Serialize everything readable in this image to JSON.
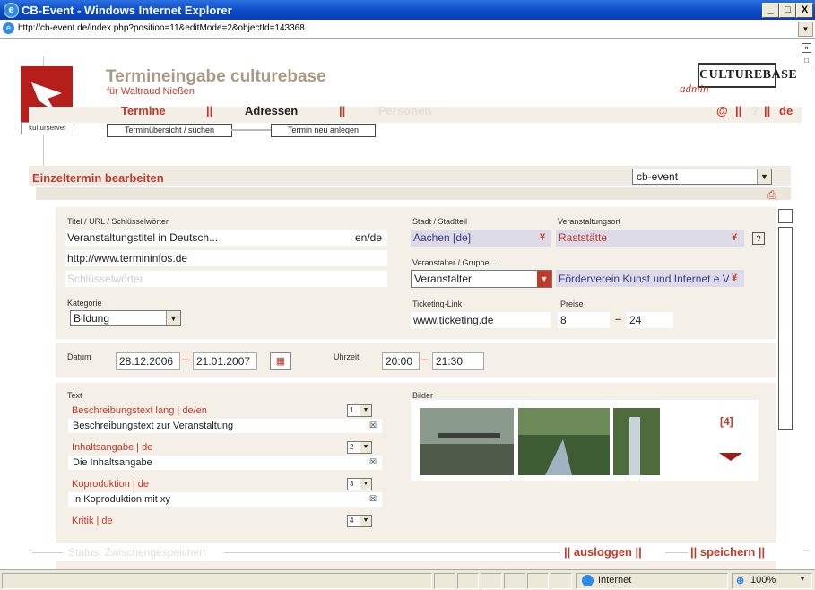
{
  "window": {
    "title": "CB-Event - Windows Internet Explorer",
    "url": "http://cb-event.de/index.php?position=11&editMode=2&objectId=143368",
    "btn_min": "_",
    "btn_max": "□",
    "btn_close": "X"
  },
  "header": {
    "logo_label": "kulturserver",
    "app_title": "Termineingabe culturebase",
    "user": "für  Waltraud Nießen",
    "brand": "CULTUREBASE",
    "brand_sub": "admin"
  },
  "nav": {
    "tabs": [
      "Termine",
      "Adressen",
      "Personen"
    ],
    "separator": "||",
    "right": [
      "@",
      "||",
      "?",
      "||",
      "de"
    ],
    "subtabs": [
      "Terminübersicht / suchen",
      "Termin neu anlegen"
    ]
  },
  "section": {
    "title": "Einzeltermin bearbeiten",
    "mandant_select": "cb-event"
  },
  "form": {
    "title_label": "Titel / URL / Schlüsselwörter",
    "title_value": "Veranstaltungstitel in Deutsch...",
    "title_lang": "en/de",
    "url_value": "http://www.termininfos.de",
    "keywords_placeholder": "Schlüsselwörter",
    "category_label": "Kategorie",
    "category_value": "Bildung",
    "city_label": "Stadt / Stadtteil",
    "city_value": "Aachen [de]",
    "venue_label": "Veranstaltungsort",
    "venue_value": "Raststätte",
    "venue_help": "?",
    "organizer_label": "Veranstalter / Gruppe ...",
    "organizer_type": "Veranstalter",
    "organizer_value": "Förderverein Kunst und Internet e.V",
    "ticket_label": "Ticketing-Link",
    "ticket_value": "www.ticketing.de",
    "price_label": "Preise",
    "price_from": "8",
    "price_to": "24",
    "dash": "–",
    "date_label": "Datum",
    "date_from": "28.12.2006",
    "date_to": "21.01.2007",
    "time_label": "Uhrzeit",
    "time_from": "20:00",
    "time_to": "21:30",
    "text_label": "Text",
    "images_label": "Bilder",
    "images_count": "[4]"
  },
  "texts": [
    {
      "title": "Beschreibungstext lang  | de/en",
      "num": "1",
      "content": "Beschreibungstext zur Veranstaltung"
    },
    {
      "title": "Inhaltsangabe  | de",
      "num": "2",
      "content": "Die Inhaltsangabe"
    },
    {
      "title": "Koproduktion  | de",
      "num": "3",
      "content": "In Koproduktion mit xy"
    },
    {
      "title": "Kritik  | de",
      "num": "4",
      "content": ""
    }
  ],
  "footer": {
    "status": "Status: Zwischengespeichert",
    "logout": "|| ausloggen ||",
    "save": "|| speichern ||"
  },
  "statusbar": {
    "zone": "Internet",
    "zoom": "100%"
  },
  "colors": {
    "accent": "#c0392b",
    "panel": "#f4f0e8",
    "titlebar": "#0a47c7"
  }
}
